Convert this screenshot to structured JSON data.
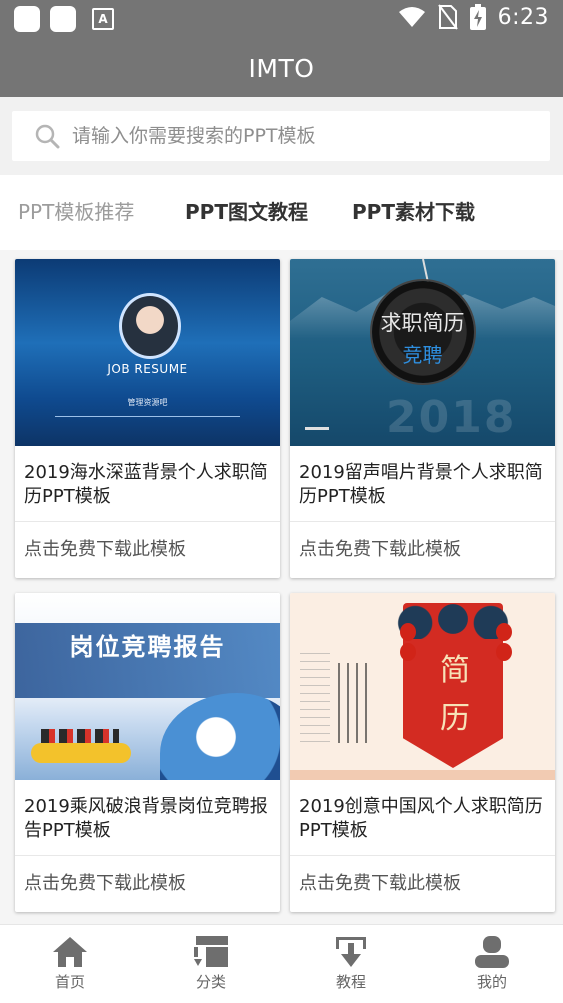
{
  "status_bar": {
    "time": "6:23"
  },
  "app_bar": {
    "title": "IMTO"
  },
  "search": {
    "placeholder": "请输入你需要搜索的PPT模板"
  },
  "tabs": [
    {
      "label": "PPT模板推荐"
    },
    {
      "label": "PPT图文教程"
    },
    {
      "label": "PPT素材下载"
    }
  ],
  "cards": [
    {
      "title": "2019海水深蓝背景个人求职简历PPT模板",
      "action": "点击免费下载此模板",
      "thumb": {
        "line1": "JOB RESUME",
        "line2": "管理资源吧"
      }
    },
    {
      "title": "2019留声唱片背景个人求职简历PPT模板",
      "action": "点击免费下载此模板",
      "thumb": {
        "line1": "求职简历",
        "line2": "竞聘",
        "line3": "2018"
      }
    },
    {
      "title": "2019乘风破浪背景岗位竞聘报告PPT模板",
      "action": "点击免费下载此模板",
      "thumb": {
        "line1": "岗位竞聘报告"
      }
    },
    {
      "title": "2019创意中国风个人求职简历PPT模板",
      "action": "点击免费下载此模板",
      "thumb": {
        "line1": "简",
        "line2": "历"
      }
    }
  ],
  "bottom_nav": [
    {
      "label": "首页",
      "icon": "home-icon"
    },
    {
      "label": "分类",
      "icon": "category-icon"
    },
    {
      "label": "教程",
      "icon": "tutorial-icon"
    },
    {
      "label": "我的",
      "icon": "user-icon"
    }
  ],
  "colors": {
    "app_bar": "#757575",
    "active_tab": "#333333",
    "inactive_tab": "#9c9c9c",
    "nav_icon": "#6e6e6e"
  }
}
